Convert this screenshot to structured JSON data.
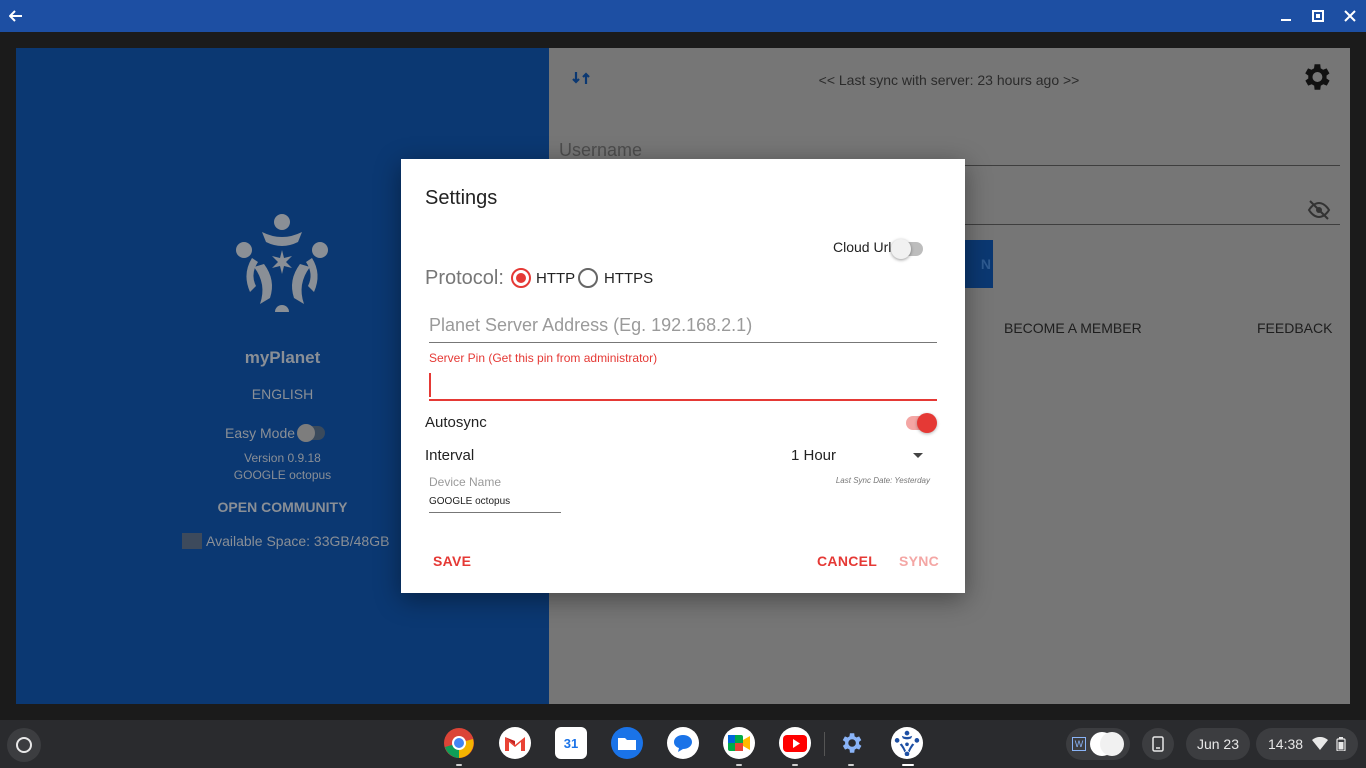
{
  "colors": {
    "title_bar": "#1d4fa3",
    "left_panel": "#0b3872",
    "accent_red": "#e53935",
    "shelf": "#2a2b2e"
  },
  "title_bar": {
    "back_icon": "arrow-left-icon",
    "window_controls": [
      "minimize-icon",
      "maximize-icon",
      "close-icon"
    ]
  },
  "left_panel": {
    "logo_icon": "myplanet-logo",
    "app_name": "myPlanet",
    "language": "ENGLISH",
    "easy_mode_label": "Easy Mode",
    "version": "Version 0.9.18",
    "device": "GOOGLE octopus",
    "community": "OPEN COMMUNITY",
    "storage_icon": "storage-icon",
    "available_space": "Available Space: 33GB/48GB"
  },
  "right_panel": {
    "sync_icon": "sync-icon",
    "last_sync": "<< Last sync with server: 23 hours ago >>",
    "settings_icon": "gear-icon",
    "username_placeholder": "Username",
    "password_visibility_icon": "eye-off-icon",
    "login_button_partial": "N",
    "become_member": "BECOME A MEMBER",
    "feedback": "FEEDBACK"
  },
  "dialog": {
    "title": "Settings",
    "cloud_url_label": "Cloud Url",
    "cloud_url_enabled": false,
    "protocol_label": "Protocol:",
    "protocol_options": [
      "HTTP",
      "HTTPS"
    ],
    "protocol_selected": "HTTP",
    "server_address_placeholder": "Planet Server Address (Eg. 192.168.2.1)",
    "server_pin_label": "Server Pin (Get this pin from administrator)",
    "server_pin_value": "",
    "autosync_label": "Autosync",
    "autosync_enabled": true,
    "interval_label": "Interval",
    "interval_value": "1 Hour",
    "device_name_label": "Device Name",
    "last_sync_date": "Last Sync Date: Yesterday",
    "device_name_value": "GOOGLE octopus",
    "save": "SAVE",
    "cancel": "CANCEL",
    "sync": "SYNC"
  },
  "shelf": {
    "apps": [
      "Chrome",
      "Gmail",
      "Calendar",
      "Files",
      "Messages",
      "Meet",
      "YouTube",
      "Settings",
      "myPlanet"
    ],
    "calendar_day": "31",
    "date": "Jun 23",
    "time": "14:38",
    "tray_icons": [
      "wifi-icon",
      "battery-icon"
    ]
  }
}
